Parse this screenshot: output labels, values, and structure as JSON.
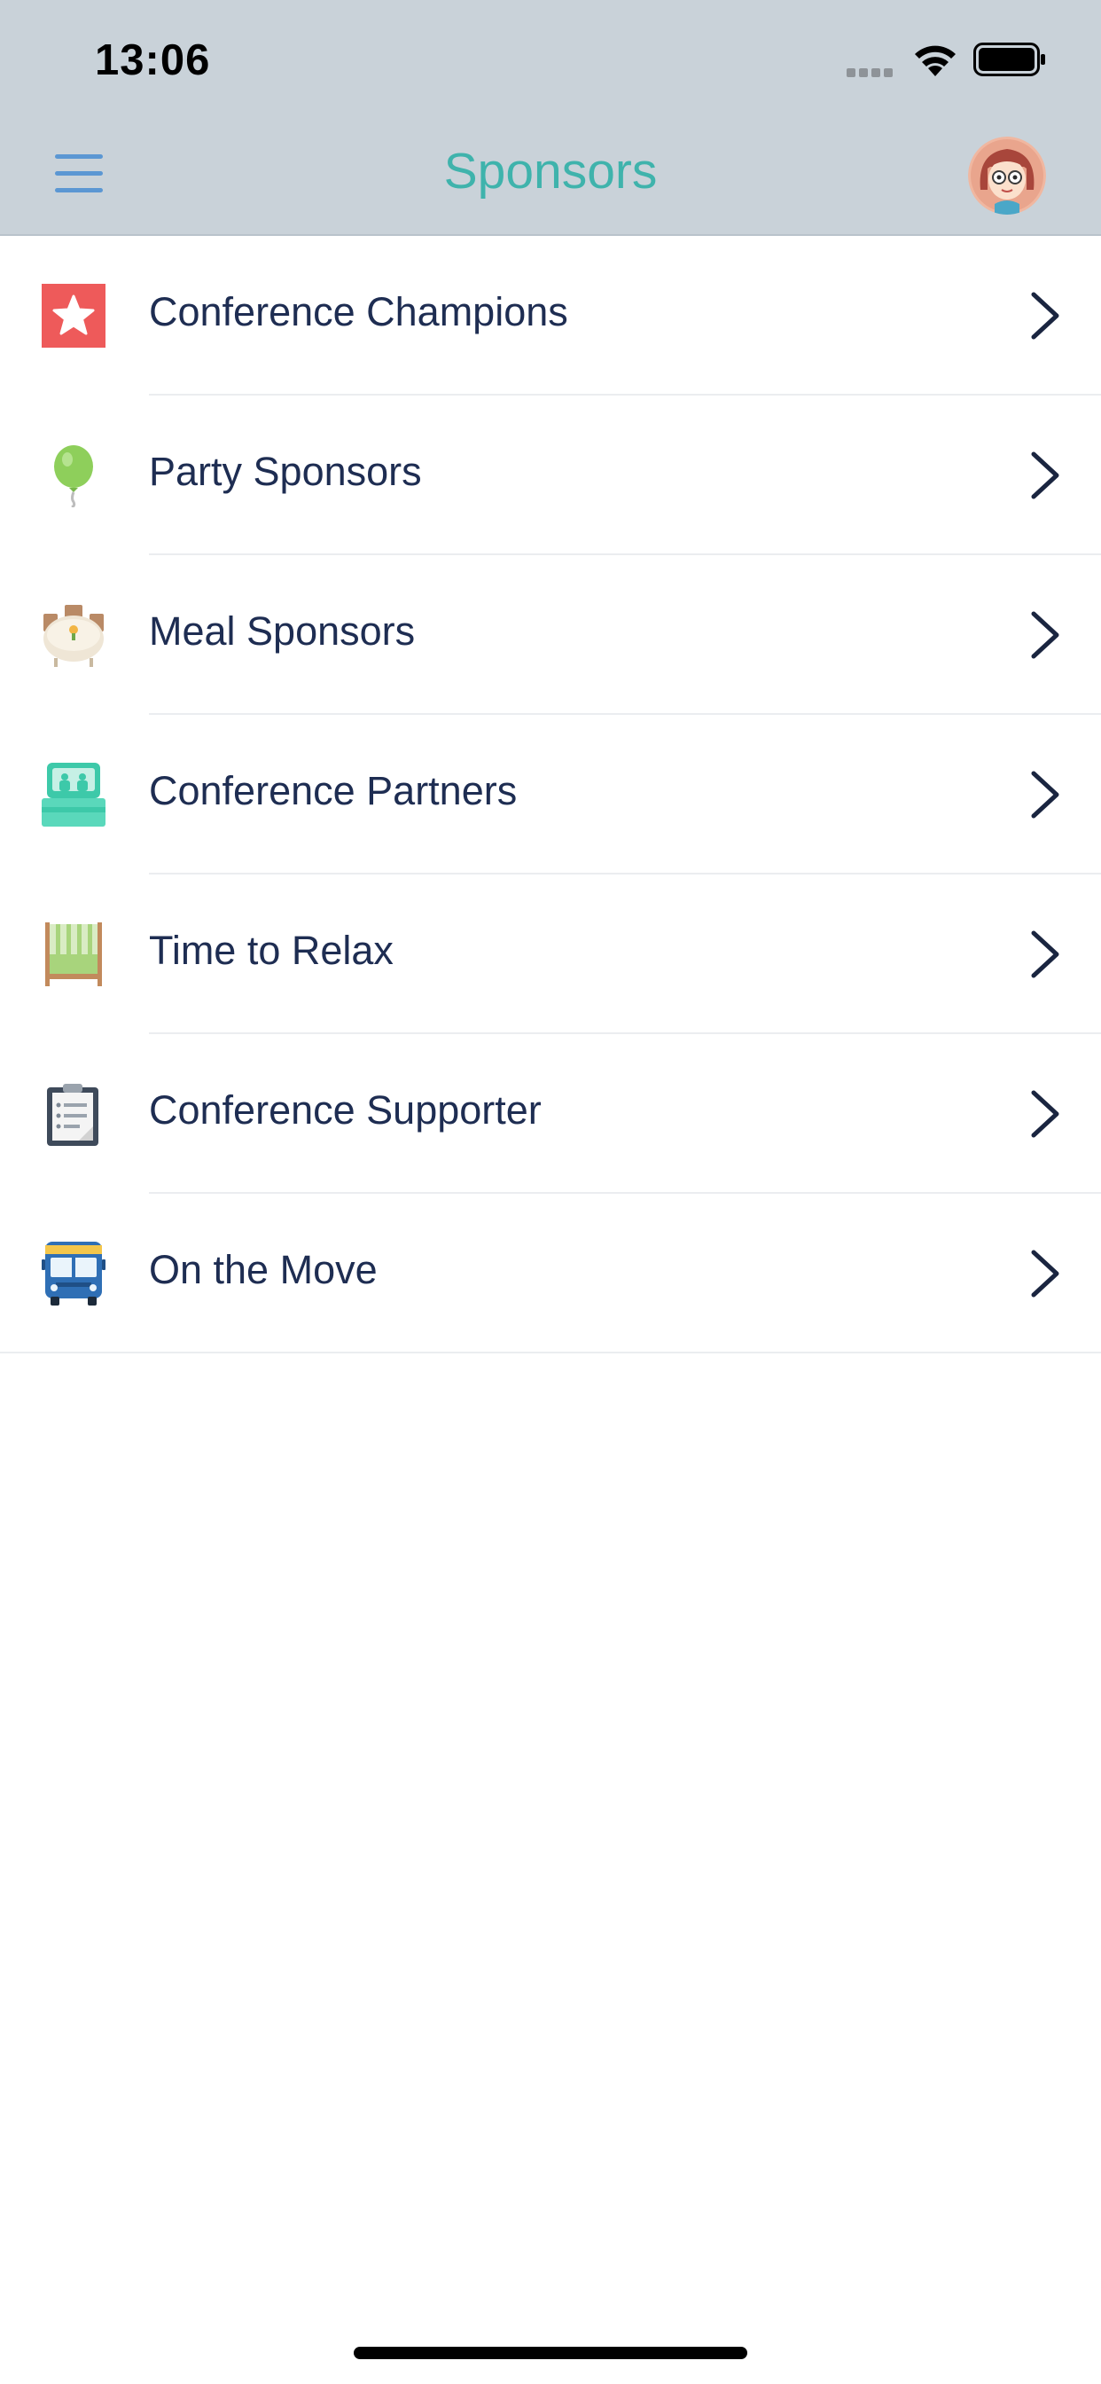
{
  "status_bar": {
    "time": "13:06"
  },
  "header": {
    "title": "Sponsors"
  },
  "sponsor_categories": [
    {
      "label": "Conference Champions",
      "icon": "star-icon"
    },
    {
      "label": "Party Sponsors",
      "icon": "balloon-icon"
    },
    {
      "label": "Meal Sponsors",
      "icon": "dining-table-icon"
    },
    {
      "label": "Conference Partners",
      "icon": "booth-icon"
    },
    {
      "label": "Time to Relax",
      "icon": "deck-chair-icon"
    },
    {
      "label": "Conference Supporter",
      "icon": "clipboard-icon"
    },
    {
      "label": "On the Move",
      "icon": "bus-icon"
    }
  ],
  "colors": {
    "header_bg": "#c9d2d9",
    "title": "#3fb3ac",
    "menu_icon": "#5b97d3",
    "list_text": "#1e2d52",
    "separator": "#ebedf0"
  }
}
